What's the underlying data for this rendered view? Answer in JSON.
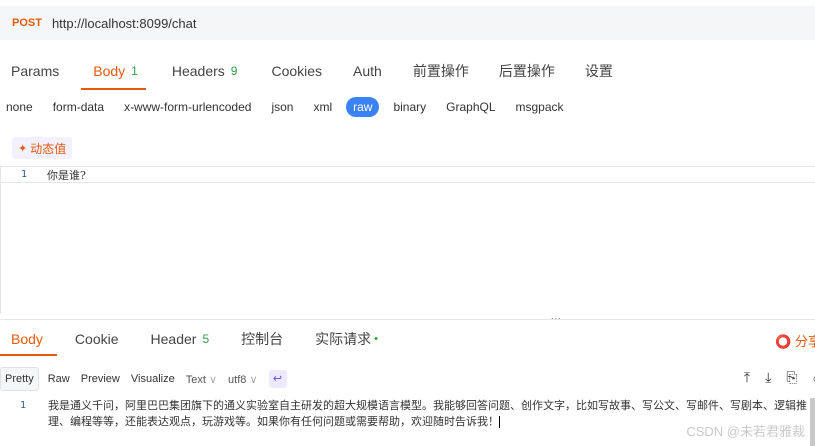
{
  "request": {
    "method": "POST",
    "url": "http://localhost:8099/chat"
  },
  "request_tabs": [
    {
      "label": "Params"
    },
    {
      "label": "Body",
      "count": "1",
      "active": true
    },
    {
      "label": "Headers",
      "count": "9"
    },
    {
      "label": "Cookies"
    },
    {
      "label": "Auth"
    },
    {
      "label": "前置操作"
    },
    {
      "label": "后置操作"
    },
    {
      "label": "设置"
    }
  ],
  "body_types": [
    "none",
    "form-data",
    "x-www-form-urlencoded",
    "json",
    "xml",
    "raw",
    "binary",
    "GraphQL",
    "msgpack"
  ],
  "body_type_selected": "raw",
  "dynamic_value_button": "动态值",
  "request_body": {
    "line_number": "1",
    "text": "你是谁?"
  },
  "splitter_handle": "...",
  "response_tabs": [
    {
      "label": "Body",
      "active": true
    },
    {
      "label": "Cookie"
    },
    {
      "label": "Header",
      "count": "5"
    },
    {
      "label": "控制台"
    },
    {
      "label": "实际请求",
      "dot": "•"
    }
  ],
  "share_label": "分享",
  "view_modes": [
    "Pretty",
    "Raw",
    "Preview",
    "Visualize"
  ],
  "view_mode_selected": "Pretty",
  "format_select": "Text",
  "encoding_select": "utf8",
  "response_body": {
    "line_number": "1",
    "text": "我是通义千问，阿里巴巴集团旗下的通义实验室自主研发的超大规模语言模型。我能够回答问题、创作文字，比如写故事、写公文、写邮件、写剧本、逻辑推理、编程等等，还能表达观点，玩游戏等。如果你有任何问题或需要帮助，欢迎随时告诉我！"
  },
  "watermark": "CSDN @未若君雅裁",
  "colors": {
    "accent": "#e8590c",
    "count_green": "#2f9e44",
    "raw_pill": "#3b82f6"
  }
}
